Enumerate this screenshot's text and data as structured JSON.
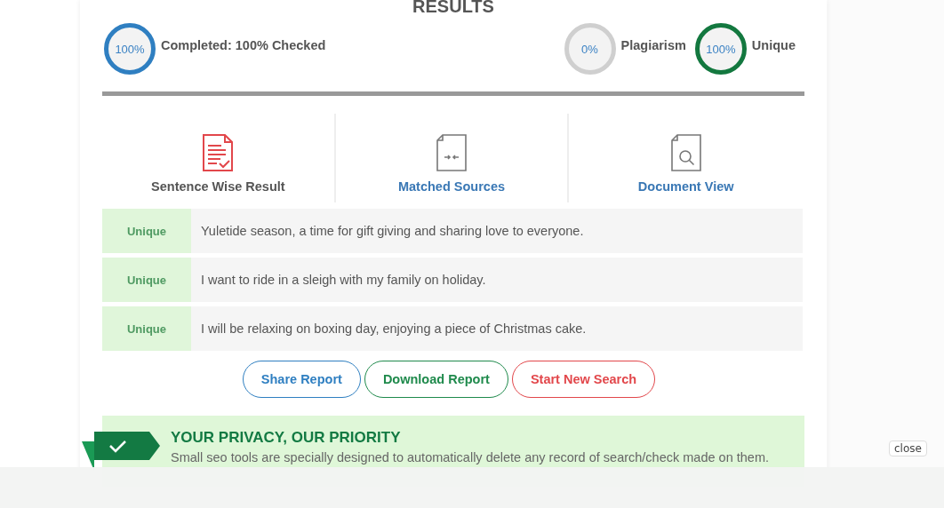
{
  "heading": "RESULTS",
  "stats": [
    {
      "reading": "100%",
      "label": "Completed: 100% Checked",
      "color": "#2f7fc1"
    },
    {
      "reading": "0%",
      "label": "Plagiarism",
      "color": "#cfcfcf"
    },
    {
      "reading": "100%",
      "label": "Unique",
      "color": "#13783f"
    }
  ],
  "progress": {
    "level": 1
  },
  "tabs": [
    {
      "kind": "sentences",
      "label": "Sentence Wise Result",
      "selected": true
    },
    {
      "kind": "sources",
      "label": "Matched Sources",
      "selected": false
    },
    {
      "kind": "document",
      "label": "Document View",
      "selected": false
    }
  ],
  "sentences": [
    {
      "status": "Unique",
      "text": "Yuletide season, a time for gift giving and sharing love to everyone."
    },
    {
      "status": "Unique",
      "text": "I want to ride in a sleigh with my family on holiday."
    },
    {
      "status": "Unique",
      "text": "I will be relaxing on boxing day, enjoying a piece of Christmas cake."
    }
  ],
  "buttons": [
    {
      "label": "Share Report",
      "color": "#2f7fc1"
    },
    {
      "label": "Download Report",
      "color": "#1f8a4c"
    },
    {
      "label": "Start New Search",
      "color": "#e2474b"
    }
  ],
  "privacy": {
    "title": "YOUR PRIVACY, OUR PRIORITY",
    "text": "Small seo tools are specially designed to automatically delete any record of search/check made on them."
  },
  "close_button": "close"
}
